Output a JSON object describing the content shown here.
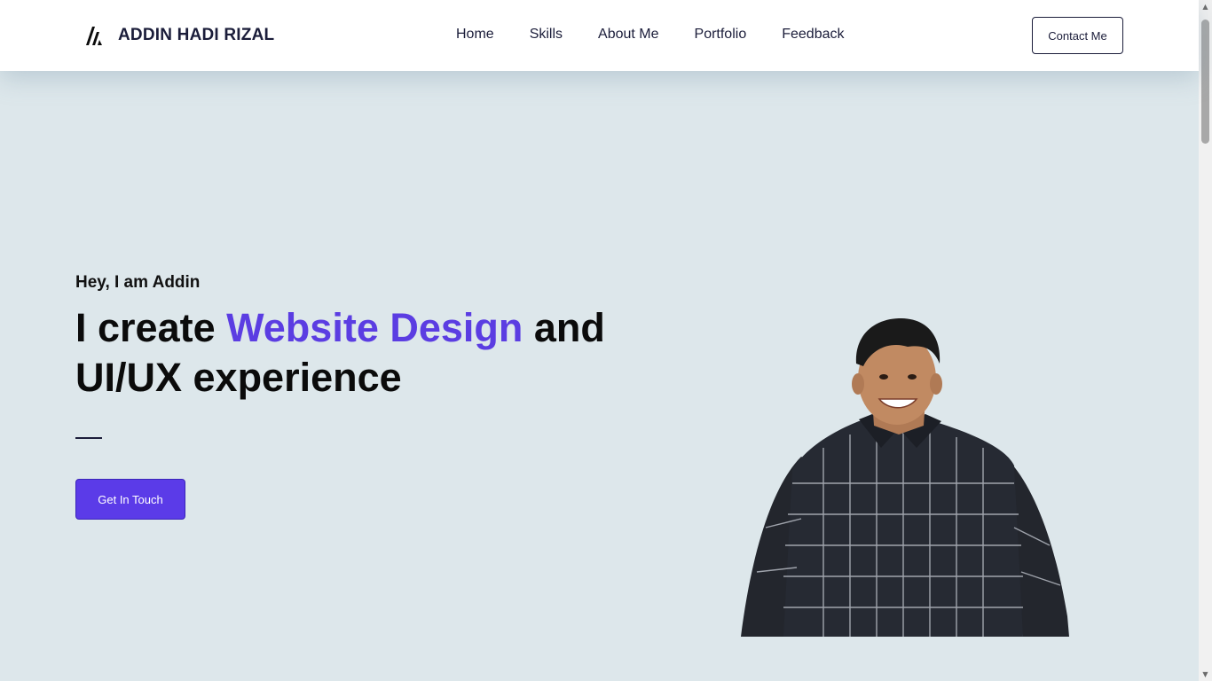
{
  "header": {
    "brand_name": "ADDIN HADI RIZAL",
    "nav": [
      "Home",
      "Skills",
      "About Me",
      "Portfolio",
      "Feedback"
    ],
    "contact_label": "Contact Me"
  },
  "hero": {
    "greeting": "Hey, I am Addin",
    "title_part1": "I create ",
    "title_accent": "Website Design",
    "title_part2": " and UI/UX experience",
    "cta_label": "Get In Touch",
    "portrait_alt": "portrait"
  },
  "colors": {
    "accent": "#5b3de2",
    "button": "#5b3be8",
    "background": "#dde7eb",
    "text_dark": "#1b1d3a"
  },
  "scrollbar": {
    "up_icon": "scroll-up-arrow-icon",
    "down_icon": "scroll-down-arrow-icon"
  }
}
